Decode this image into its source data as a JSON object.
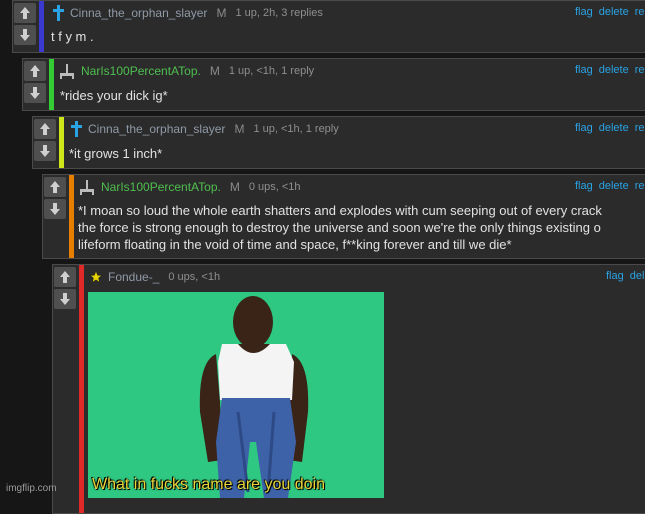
{
  "comments": [
    {
      "username": "Cinna_the_orphan_slayer",
      "mod": "M",
      "meta": "1 up, 2h, 3 replies",
      "text": "t f y m .",
      "flag": "flag",
      "delete": "delete",
      "reply": "re"
    },
    {
      "username": "NarIs100PercentATop.",
      "mod": "M",
      "meta": "1 up, <1h, 1 reply",
      "text": "*rides your dick ig*",
      "flag": "flag",
      "delete": "delete",
      "reply": "re"
    },
    {
      "username": "Cinna_the_orphan_slayer",
      "mod": "M",
      "meta": "1 up, <1h, 1 reply",
      "text": "*it grows 1 inch*",
      "flag": "flag",
      "delete": "delete",
      "reply": "re"
    },
    {
      "username": "NarIs100PercentATop.",
      "mod": "M",
      "meta": "0 ups, <1h",
      "lines": [
        "*I moan so loud the whole earth shatters and explodes with cum seeping out of every crack",
        "the force is strong enough to destroy the universe and soon we're the only things existing o",
        "lifeform floating in the void of time and space, f**king forever and till we die*"
      ],
      "flag": "flag",
      "delete": "delete",
      "reply": "re"
    },
    {
      "username": "Fondue-_",
      "meta": "0 ups, <1h",
      "flag": "flag",
      "delete": "del",
      "image_caption": "What in fucks name are you doin"
    }
  ],
  "watermark": "imgflip.com",
  "colors": {
    "bar1": "#3a3ad0",
    "bar2": "#33cc33",
    "bar3": "#cce61a",
    "bar4": "#e67e00",
    "bar5": "#e02a2a",
    "link": "#2aa3e4",
    "meme_bg": "#2ec882"
  },
  "icons": {
    "vote_up": "up-arrow-icon",
    "vote_down": "down-arrow-icon",
    "cross": "cross-icon",
    "sword": "sword-icon",
    "star": "star-icon"
  }
}
